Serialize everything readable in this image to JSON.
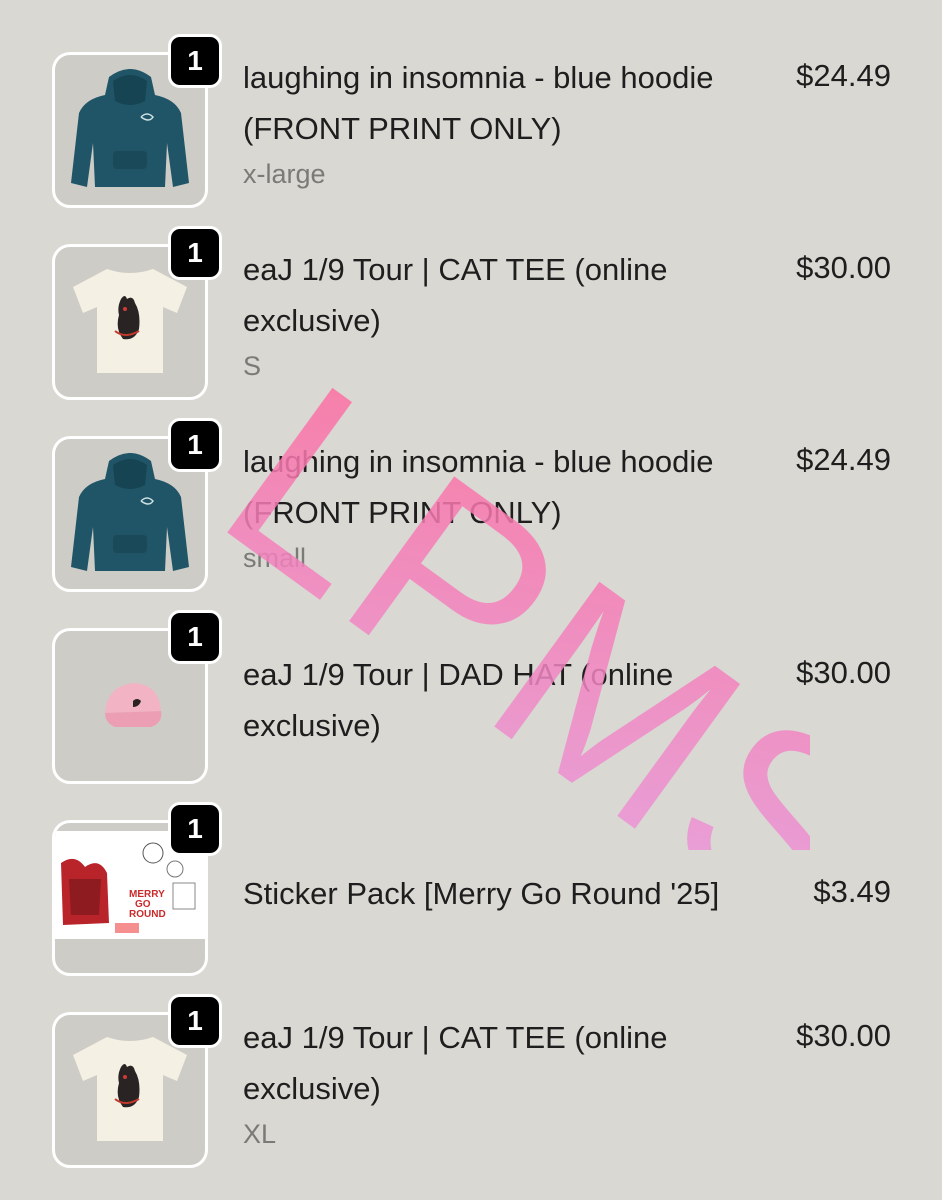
{
  "cart": {
    "items": [
      {
        "quantity": "1",
        "name": "laughing in insomnia - blue hoodie (FRONT PRINT ONLY)",
        "variant": "x-large",
        "price": "$24.49"
      },
      {
        "quantity": "1",
        "name": "eaJ 1/9 Tour | CAT TEE (online exclusive)",
        "variant": "S",
        "price": "$30.00"
      },
      {
        "quantity": "1",
        "name": "laughing in insomnia - blue hoodie (FRONT PRINT ONLY)",
        "variant": "small",
        "price": "$24.49"
      },
      {
        "quantity": "1",
        "name": "eaJ 1/9 Tour | DAD HAT (online exclusive)",
        "variant": "",
        "price": "$30.00"
      },
      {
        "quantity": "1",
        "name": "Sticker Pack [Merry Go Round '25]",
        "variant": "",
        "price": "$3.49"
      },
      {
        "quantity": "1",
        "name": "eaJ 1/9 Tour | CAT TEE (online exclusive)",
        "variant": "XL",
        "price": "$30.00"
      }
    ]
  },
  "sticker_thumb_text": [
    "MERRY",
    "GO",
    "ROUND"
  ],
  "watermark": {
    "text": "LPMS",
    "color_start": "#ff6b9b",
    "color_end": "#e6a0e8"
  },
  "colors": {
    "background": "#d9d8d3",
    "badge": "#000000",
    "text": "#1e1e1e",
    "muted": "#7a7a76"
  }
}
